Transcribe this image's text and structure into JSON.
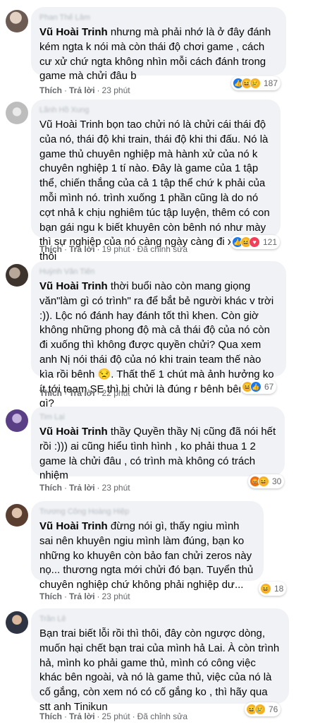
{
  "comments": [
    {
      "author": "Phan Thế Lâm",
      "mention": "Vũ Hoài Trinh",
      "text": " nhưng mà phải nhớ là ở đây đánh kém ngta k nói mà còn thái độ chơi game , cách cư xử chứ ngta không nhìn mỗi cách đánh trong game mà chửi đâu b",
      "like": "Thích",
      "reply": "Trả lời",
      "time": "23 phút",
      "edited": "",
      "reactions": [
        "like-icon",
        "haha-icon",
        "sad-icon"
      ],
      "count": "187"
    },
    {
      "author": "Lãnh Hồ Xung",
      "mention": "",
      "text": "Vũ Hoài Trinh bọn tao chửi nó là chửi cái thái độ của nó, thái độ khi train, thái độ khi thi đấu. Nó là game thủ chuyên nghiệp mà hành xử của nó k chuyên nghiệp 1 tí nào. Đây là game của 1 tập thể, chiến thắng của cả 1 tập thể chứ k phải của mỗi mình nó. trình xuống 1 phần cũng là do nó cợt nhả k chịu nghiêm túc tập luyện, thêm có con bạn gái ngu k biết khuyên còn bênh nó như mày thì sự nghiệp của nó càng ngày càng đi xuống thôi",
      "like": "Thích",
      "reply": "Trả lời",
      "time": "19 phút",
      "edited": "Đã chỉnh sửa",
      "reactions": [
        "like-icon",
        "haha-icon",
        "love-icon"
      ],
      "count": "121"
    },
    {
      "author": "Huỳnh Văn Tiến",
      "mention": "Vũ Hoài Trinh",
      "text": " thời buổi nào còn mang giọng văn\"làm gì có trình\" ra để bắt bẻ người khác v trời :)). Lộc nó đánh hay đánh tốt thì khen. Còn giờ không những phong độ mà cả thái độ của nó còn đi xuống thì không được quyền chửi? Qua xem anh Nị nói thái độ của nó khi train team thế nào kìa rồi bênh 😒. Thất thế 1 chút mà ảnh hưởng ko ít tới team SE thì bị chửi là đúng r bênh bênh cái gì?",
      "like": "Thích",
      "reply": "Trả lời",
      "time": "22 phút",
      "edited": "",
      "reactions": [
        "haha-icon",
        "like-icon"
      ],
      "count": "67"
    },
    {
      "author": "Tim Lại",
      "mention": "Vũ Hoài Trinh",
      "text": " thầy Quyền thầy Nị cũng đã nói hết rồi :))) ai cũng hiểu tình hình , ko phải thua 1 2 game là chửi đâu , có trình mà không có trách nhiệm",
      "like": "Thích",
      "reply": "Trả lời",
      "time": "23 phút",
      "edited": "",
      "reactions": [
        "angry-icon",
        "haha-icon"
      ],
      "count": "30"
    },
    {
      "author": "Trương Công Hoàng Hiệp",
      "mention": "Vũ Hoài Trinh",
      "text": " đừng nói gì, thấy ngiu mình sai nên khuyên ngiu mình làm đúng, bạn ko những ko khuyên còn bảo fan chửi zeros này nọ... thương ngta mới chửi đó bạn. Tuyển thủ chuyên nghiệp chứ không phải nghiệp dư...",
      "like": "Thích",
      "reply": "Trả lời",
      "time": "23 phút",
      "edited": "",
      "reactions": [
        "haha-icon"
      ],
      "count": "18"
    },
    {
      "author": "Trần Lê",
      "mention": "",
      "text": "Bạn trai biết lỗi rồi thì thôi, đây còn ngược dòng, muốn hại chết bạn trai của mình hả Lai. À còn trình hả, mình ko phải game thủ, mình có công việc khác bên ngoài, và nó là game thủ, việc của nó là cố gắng, còn xem nó có cố gắng ko , thì hãy qua stt anh Tinikun",
      "like": "Thích",
      "reply": "Trả lời",
      "time": "25 phút",
      "edited": "Đã chỉnh sửa",
      "reactions": [
        "haha-icon",
        "sad-icon"
      ],
      "count": "76"
    }
  ],
  "colors": {
    "bubble": "#f0f2f5",
    "meta": "#65676b",
    "like": "#1877f2",
    "haha": "#f7b125",
    "love": "#f33e58",
    "angry": "#e9710f"
  }
}
